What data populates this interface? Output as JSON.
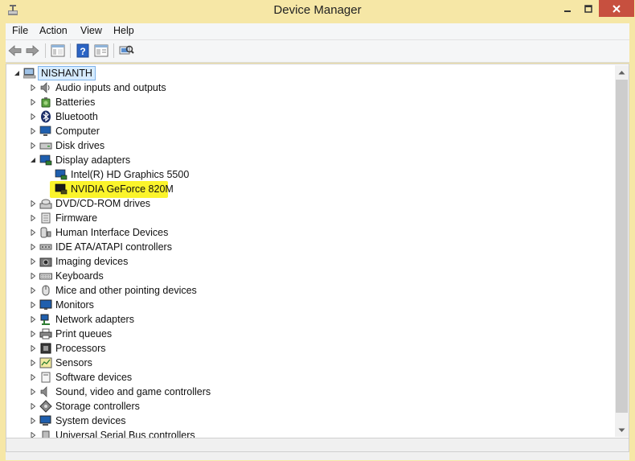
{
  "window": {
    "title": "Device Manager"
  },
  "menu": [
    "File",
    "Action",
    "View",
    "Help"
  ],
  "toolbar": [
    "back-icon",
    "forward-icon",
    "show-hide-console-tree-icon",
    "help-icon",
    "properties-icon",
    "scan-hardware-icon"
  ],
  "tree": {
    "root": "NISHANTH",
    "categories": [
      {
        "label": "Audio inputs and outputs",
        "icon": "speaker-icon"
      },
      {
        "label": "Batteries",
        "icon": "battery-icon"
      },
      {
        "label": "Bluetooth",
        "icon": "bluetooth-icon"
      },
      {
        "label": "Computer",
        "icon": "computer-icon"
      },
      {
        "label": "Disk drives",
        "icon": "disk-drive-icon"
      },
      {
        "label": "Display adapters",
        "icon": "display-adapter-icon",
        "expanded": true,
        "children": [
          {
            "label": "Intel(R) HD Graphics 5500",
            "icon": "display-adapter-icon"
          },
          {
            "label": "NVIDIA GeForce 820M",
            "icon": "display-adapter-icon",
            "highlighted": true
          }
        ]
      },
      {
        "label": "DVD/CD-ROM drives",
        "icon": "dvd-drive-icon"
      },
      {
        "label": "Firmware",
        "icon": "firmware-icon"
      },
      {
        "label": "Human Interface Devices",
        "icon": "hid-icon"
      },
      {
        "label": "IDE ATA/ATAPI controllers",
        "icon": "ide-controller-icon"
      },
      {
        "label": "Imaging devices",
        "icon": "camera-icon"
      },
      {
        "label": "Keyboards",
        "icon": "keyboard-icon"
      },
      {
        "label": "Mice and other pointing devices",
        "icon": "mouse-icon"
      },
      {
        "label": "Monitors",
        "icon": "monitor-icon"
      },
      {
        "label": "Network adapters",
        "icon": "network-icon"
      },
      {
        "label": "Print queues",
        "icon": "printer-icon"
      },
      {
        "label": "Processors",
        "icon": "processor-icon"
      },
      {
        "label": "Sensors",
        "icon": "sensor-icon"
      },
      {
        "label": "Software devices",
        "icon": "software-device-icon"
      },
      {
        "label": "Sound, video and game controllers",
        "icon": "sound-icon"
      },
      {
        "label": "Storage controllers",
        "icon": "storage-controller-icon"
      },
      {
        "label": "System devices",
        "icon": "system-device-icon"
      },
      {
        "label": "Universal Serial Bus controllers",
        "icon": "usb-icon"
      }
    ]
  },
  "colors": {
    "highlight": "#fbf42b",
    "titlebar": "#f6e7a6",
    "close": "#c7503f",
    "selection": "#d6ebff"
  }
}
